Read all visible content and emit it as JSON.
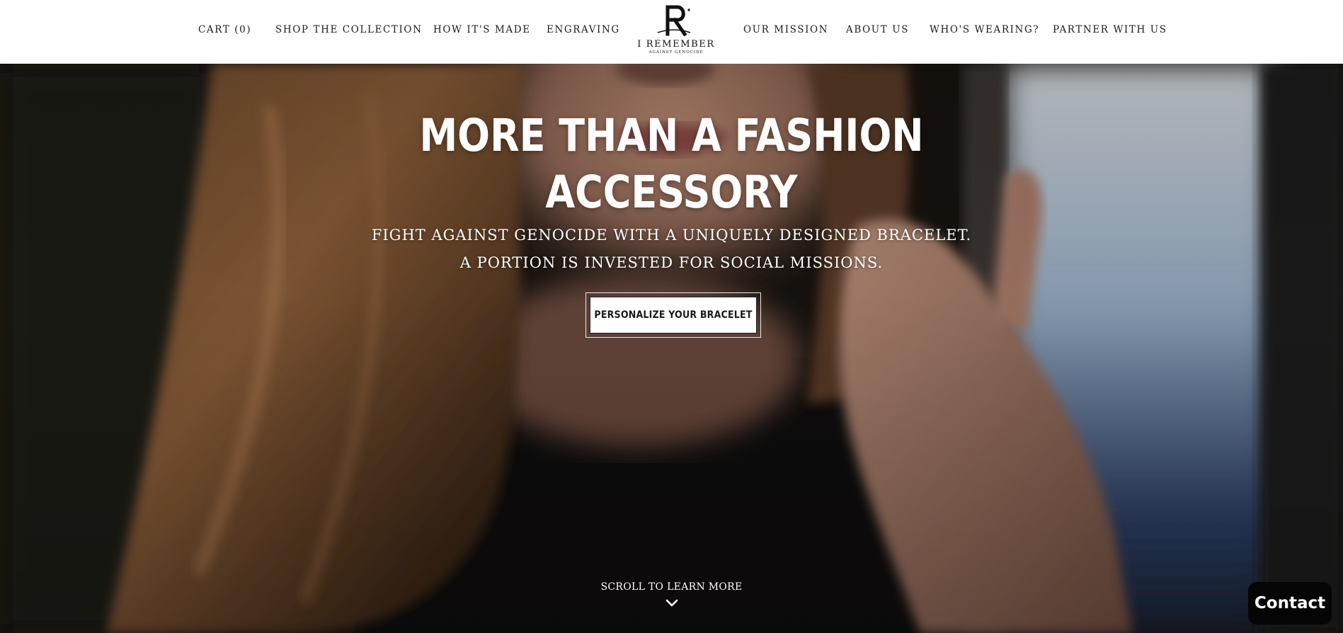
{
  "header": {
    "nav_left": [
      {
        "label": "CART (0)"
      },
      {
        "label": "SHOP THE COLLECTION"
      },
      {
        "label": "HOW IT'S MADE"
      },
      {
        "label": "ENGRAVING"
      }
    ],
    "nav_right": [
      {
        "label": "OUR MISSION"
      },
      {
        "label": "ABOUT US"
      },
      {
        "label": "WHO'S WEARING?"
      },
      {
        "label": "PARTNER WITH US"
      }
    ],
    "logo": {
      "mark": "R",
      "title": "I REMEMBER",
      "subtitle": "AGAINST GENOCIDE"
    }
  },
  "hero": {
    "title_line1": "MORE THAN A FASHION",
    "title_line2": "ACCESSORY",
    "subtitle_line1": "FIGHT AGAINST GENOCIDE WITH A UNIQUELY DESIGNED BRACELET.",
    "subtitle_line2": "A PORTION IS INVESTED FOR SOCIAL MISSIONS.",
    "cta_label": "PERSONALIZE YOUR BRACELET",
    "scroll_label": "SCROLL TO LEARN MORE"
  },
  "contact": {
    "label": "Contact"
  }
}
